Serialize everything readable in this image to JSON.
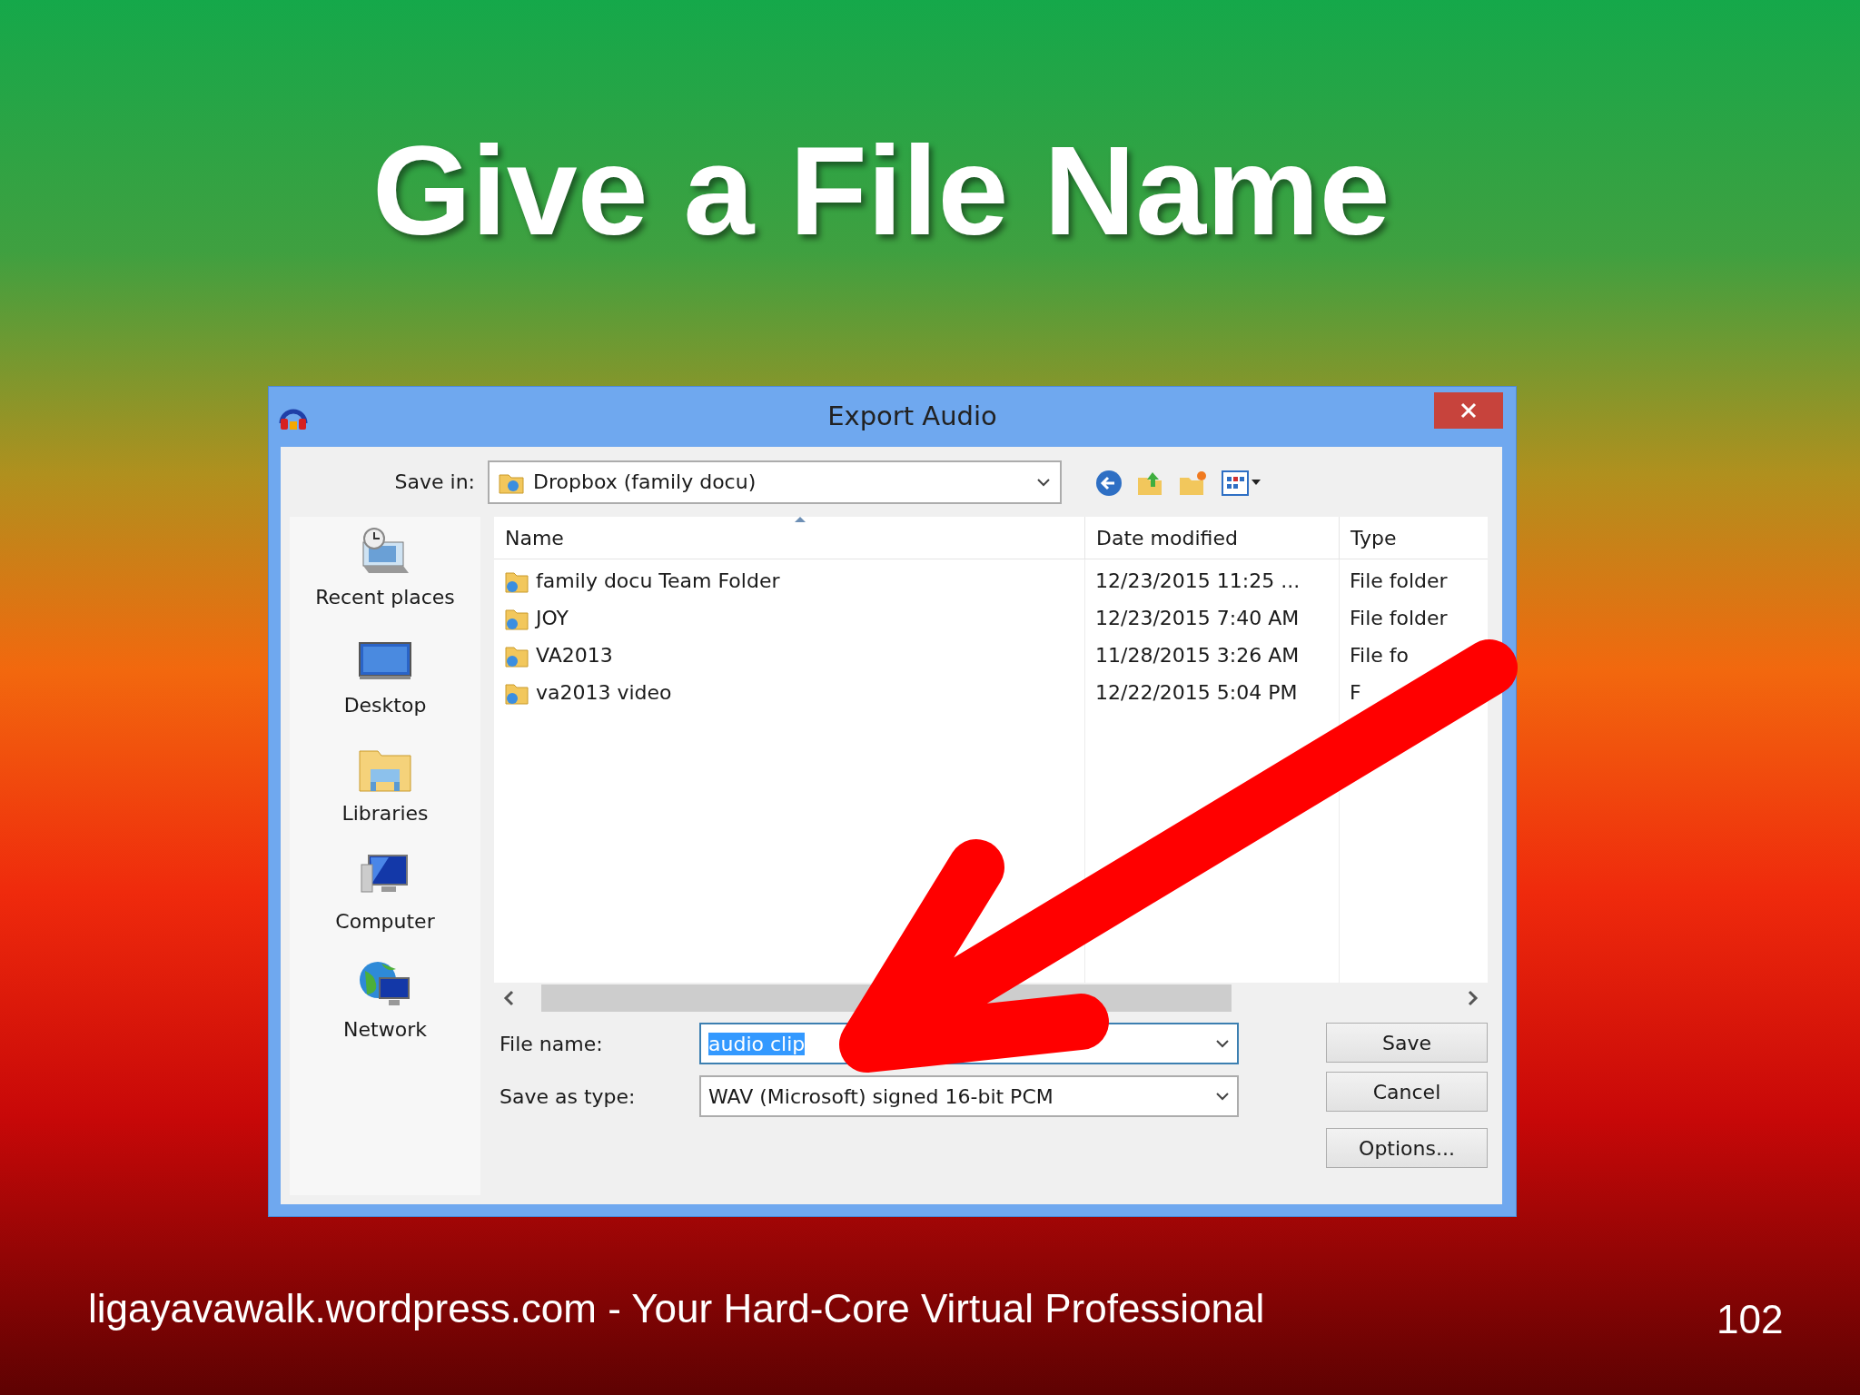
{
  "slide": {
    "title": "Give a File Name",
    "footer": "ligayavawalk.wordpress.com - Your Hard-Core Virtual Professional",
    "page_number": "102"
  },
  "window": {
    "title": "Export Audio"
  },
  "save_in": {
    "label": "Save in:",
    "value": "Dropbox (family docu)"
  },
  "places": [
    {
      "label": "Recent places",
      "kind": "recent"
    },
    {
      "label": "Desktop",
      "kind": "desktop"
    },
    {
      "label": "Libraries",
      "kind": "libraries"
    },
    {
      "label": "Computer",
      "kind": "computer"
    },
    {
      "label": "Network",
      "kind": "network"
    }
  ],
  "file_list": {
    "columns": [
      {
        "label": "Name",
        "sorted": true
      },
      {
        "label": "Date modified",
        "sorted": false
      },
      {
        "label": "Type",
        "sorted": false
      }
    ],
    "rows": [
      {
        "name": "family docu Team Folder",
        "date": "12/23/2015 11:25 ...",
        "type": "File folder"
      },
      {
        "name": "JOY",
        "date": "12/23/2015 7:40 AM",
        "type": "File folder"
      },
      {
        "name": "VA2013",
        "date": "11/28/2015 3:26 AM",
        "type": "File fo"
      },
      {
        "name": "va2013 video",
        "date": "12/22/2015 5:04 PM",
        "type": "F"
      }
    ]
  },
  "file_name": {
    "label": "File name:",
    "value": "audio clip",
    "text_selected": true
  },
  "save_as_type": {
    "label": "Save as type:",
    "value": "WAV (Microsoft) signed 16-bit PCM"
  },
  "buttons": [
    "Save",
    "Cancel",
    "Options..."
  ]
}
